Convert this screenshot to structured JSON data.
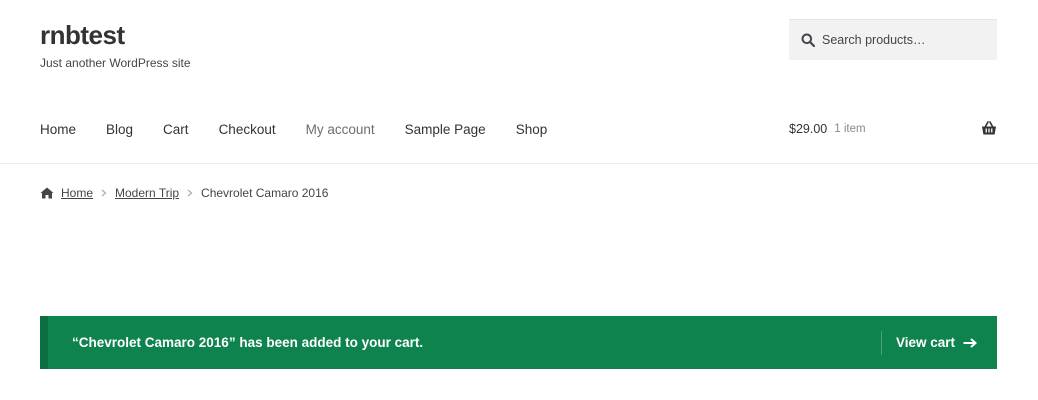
{
  "site": {
    "title": "rnbtest",
    "description": "Just another WordPress site"
  },
  "search": {
    "placeholder": "Search products…",
    "value": "",
    "icon": "search-icon"
  },
  "nav": {
    "items": [
      {
        "label": "Home"
      },
      {
        "label": "Blog"
      },
      {
        "label": "Cart"
      },
      {
        "label": "Checkout"
      },
      {
        "label": "My account"
      },
      {
        "label": "Sample Page"
      },
      {
        "label": "Shop"
      }
    ]
  },
  "mini_cart": {
    "amount": "$29.00",
    "count": "1 item",
    "icon": "basket-icon"
  },
  "breadcrumb": {
    "home": "Home",
    "category": "Modern Trip",
    "current": "Chevrolet Camaro 2016"
  },
  "notice": {
    "message": "“Chevrolet Camaro 2016” has been added to your cart.",
    "view_cart": "View cart",
    "bg_color": "#0f834d"
  }
}
